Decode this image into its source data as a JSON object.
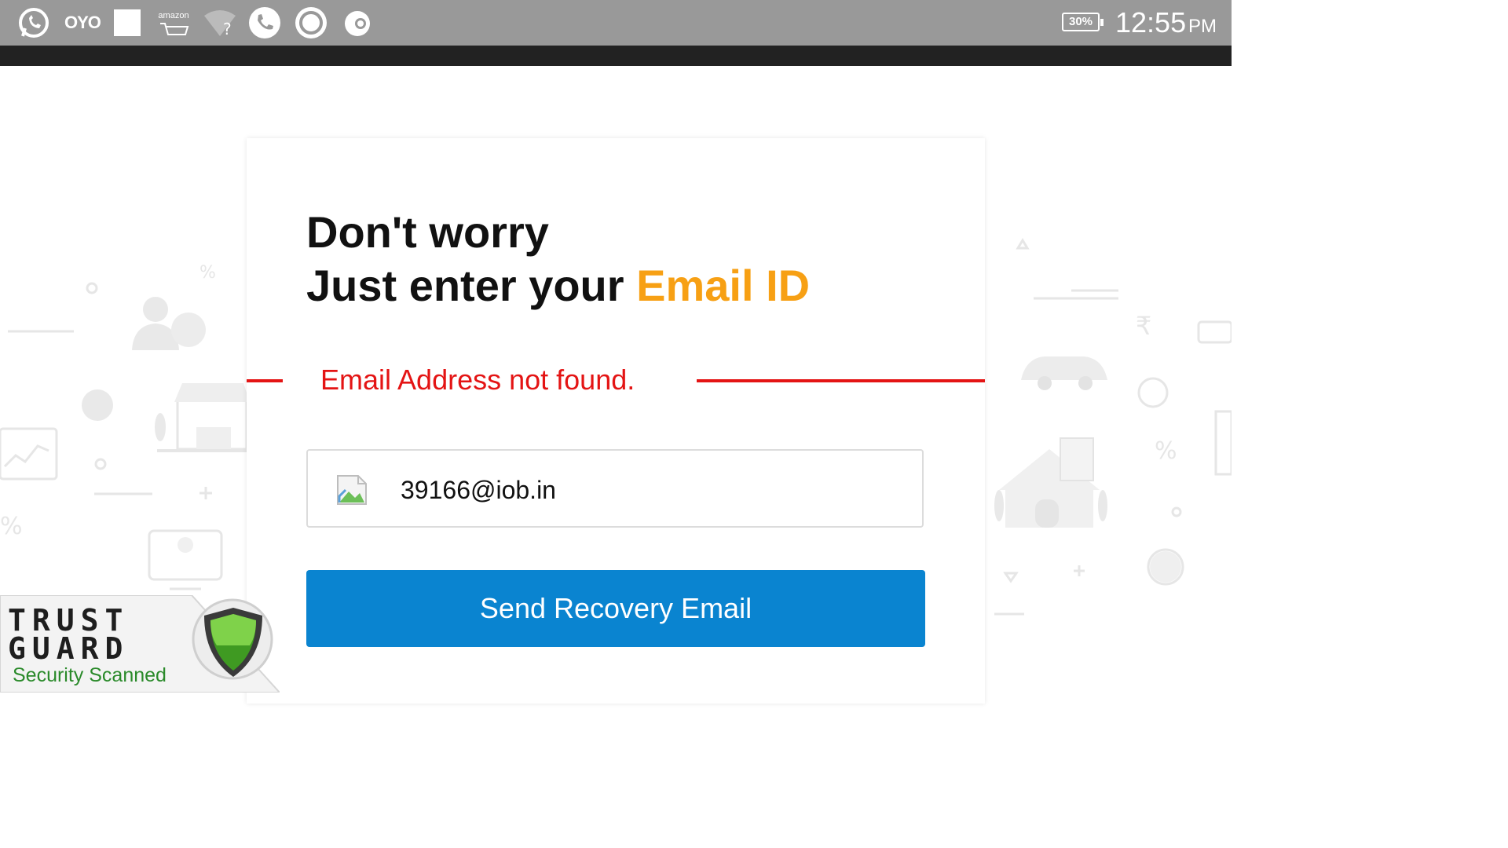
{
  "status_bar": {
    "icons": [
      "whatsapp-icon",
      "oyo-icon",
      "square-icon",
      "amazon-icon",
      "wifi-question-icon",
      "phone-icon",
      "circle-app-icon",
      "chrome-like-icon"
    ],
    "oyo_label": "OYO",
    "amazon_label": "amazon",
    "battery": "30%",
    "time": "12:55",
    "ampm": "PM"
  },
  "card": {
    "heading_line1": "Don't worry",
    "heading_line2_prefix": "Just enter your ",
    "heading_line2_accent": "Email ID",
    "error_message": "Email Address not found.",
    "email_value": "39166@iob.in",
    "button_label": "Send Recovery Email"
  },
  "trust_guard": {
    "line1": "TRUST",
    "line2": "GUARD",
    "line3": "Security Scanned"
  },
  "colors": {
    "accent": "#f7a014",
    "error": "#e41414",
    "button": "#0a84d0",
    "status_bar": "#999999"
  }
}
